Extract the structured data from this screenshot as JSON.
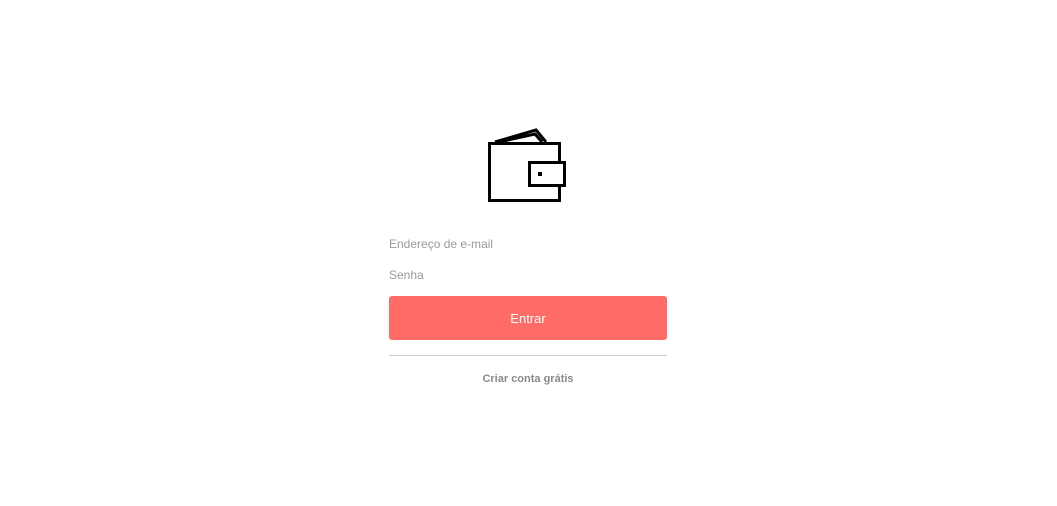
{
  "logo": {
    "icon": "wallet-icon"
  },
  "form": {
    "email_placeholder": "Endereço de e-mail",
    "password_placeholder": "Senha",
    "submit_label": "Entrar"
  },
  "signup_link": "Criar conta grátis",
  "colors": {
    "accent": "#ff6b66",
    "link": "#8a8a8a",
    "placeholder": "#9a9a9a",
    "divider": "#cccccc"
  }
}
